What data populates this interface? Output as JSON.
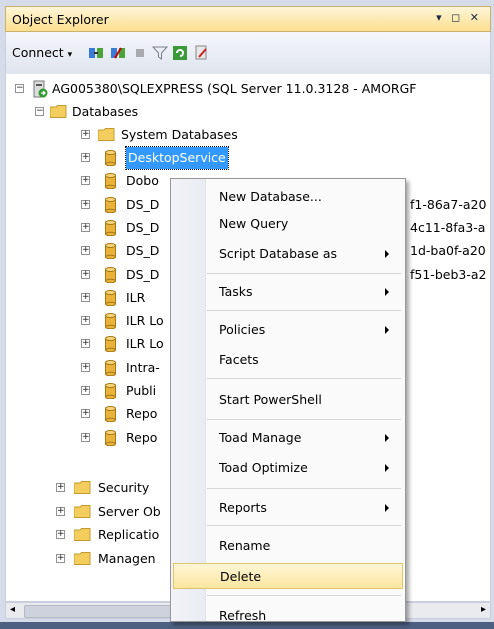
{
  "panel": {
    "title": "Object Explorer",
    "controls": "▾ ◻ ✕",
    "connect_label": "Connect",
    "connect_caret": "▾"
  },
  "toolbar_icons": [
    "connect-object-explorer-icon",
    "disconnect-icon",
    "stop-icon",
    "filter-icon",
    "refresh-icon",
    "reports-icon"
  ],
  "tree": {
    "server": "AG005380\\SQLEXPRESS (SQL Server 11.0.3128 - AMORGF",
    "databases": "Databases",
    "system_databases": "System Databases",
    "items": [
      {
        "label": "DesktopService",
        "trail": ""
      },
      {
        "label": "Dobo",
        "trail": ""
      },
      {
        "label": "DS_D",
        "trail": "f1-86a7-a20"
      },
      {
        "label": "DS_D",
        "trail": "4c11-8fa3-a"
      },
      {
        "label": "DS_D",
        "trail": "1d-ba0f-a20"
      },
      {
        "label": "DS_D",
        "trail": "f51-beb3-a2"
      },
      {
        "label": "ILR",
        "trail": ""
      },
      {
        "label": "ILR Lo",
        "trail": ""
      },
      {
        "label": "ILR Lo",
        "trail": ""
      },
      {
        "label": "Intra-",
        "trail": ""
      },
      {
        "label": "Publi",
        "trail": ""
      },
      {
        "label": "Repo",
        "trail": ""
      },
      {
        "label": "Repo",
        "trail": ""
      }
    ],
    "folders": [
      "Security",
      "Server Ob",
      "Replicatio",
      "Managen"
    ]
  },
  "menu": {
    "items": [
      {
        "label": "New Database...",
        "sub": false
      },
      {
        "label": "New Query",
        "sub": false
      },
      {
        "label": "Script Database as",
        "sub": true
      },
      {
        "label": "Tasks",
        "sub": true
      },
      {
        "label": "Policies",
        "sub": true
      },
      {
        "label": "Facets",
        "sub": false
      },
      {
        "label": "Start PowerShell",
        "sub": false
      },
      {
        "label": "Toad Manage",
        "sub": true
      },
      {
        "label": "Toad Optimize",
        "sub": true
      },
      {
        "label": "Reports",
        "sub": true
      },
      {
        "label": "Rename",
        "sub": false
      },
      {
        "label": "Delete",
        "sub": false
      },
      {
        "label": "Refresh",
        "sub": false
      }
    ],
    "highlighted": "Delete"
  },
  "colors": {
    "selection": "#3399ff",
    "highlight": "#fbe69f",
    "folder": "#f3cd5e",
    "database": "#e9b23a"
  }
}
